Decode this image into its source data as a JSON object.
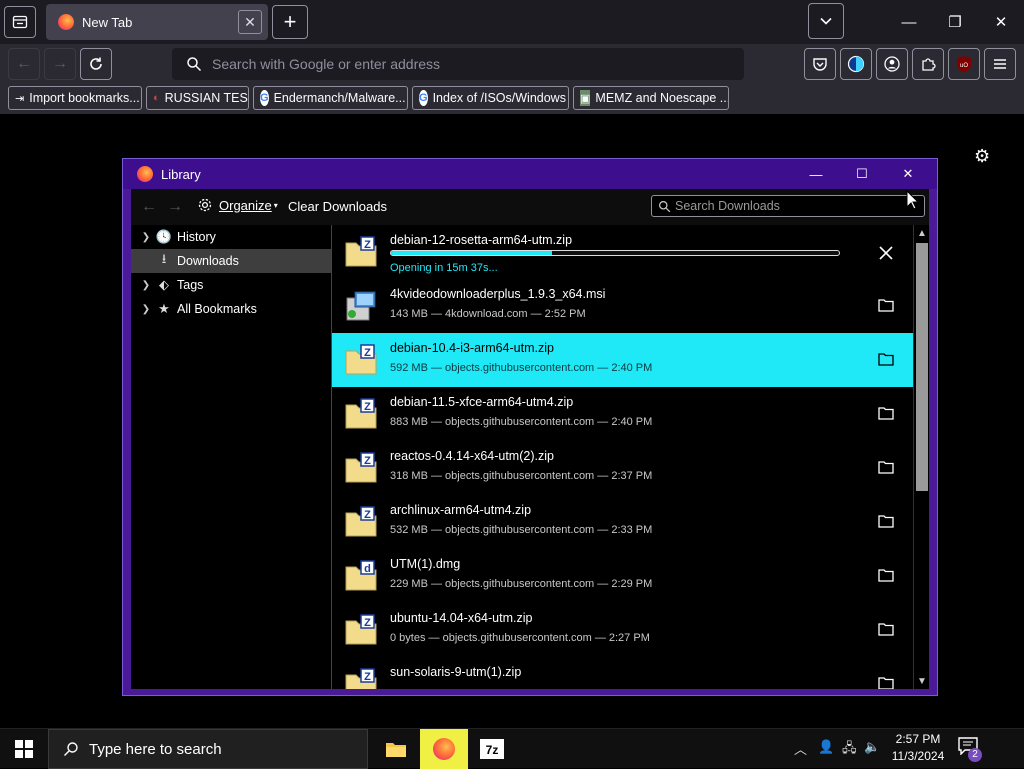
{
  "browser": {
    "active_tab": {
      "title": "New Tab",
      "close": "✕"
    },
    "new_tab": "+",
    "window": {
      "minimize": "—",
      "restore": "❐",
      "close": "✕"
    },
    "url_placeholder": "Search with Google or enter address",
    "bookmarks": [
      {
        "label": "Import bookmarks...",
        "icon": "import-icon"
      },
      {
        "label": "RUSSIAN TEST",
        "icon": "site-icon"
      },
      {
        "label": "Endermanch/Malware...",
        "icon": "google-icon"
      },
      {
        "label": "Index of /ISOs/Windows",
        "icon": "google-icon"
      },
      {
        "label": "MEMZ and Noescape ...",
        "icon": "video-icon"
      }
    ]
  },
  "library": {
    "title": "Library",
    "controls": {
      "minimize": "—",
      "maximize": "☐",
      "close": "✕"
    },
    "toolbar": {
      "organize": "Organize",
      "clear": "Clear Downloads",
      "search_placeholder": "Search Downloads"
    },
    "tree": [
      {
        "label": "History",
        "icon": "clock-icon",
        "twisty": "❯",
        "selected": false
      },
      {
        "label": "Downloads",
        "icon": "download-icon",
        "twisty": "",
        "selected": true
      },
      {
        "label": "Tags",
        "icon": "tag-icon",
        "twisty": "❯",
        "selected": false
      },
      {
        "label": "All Bookmarks",
        "icon": "star-icon",
        "twisty": "❯",
        "selected": false
      }
    ],
    "downloads": [
      {
        "name": "debian-12-rosetta-arm64-utm.zip",
        "status": "Opening in 15m 37s...",
        "progress": 0.36,
        "in_progress": true,
        "icon": "zip-icon"
      },
      {
        "name": "4kvideodownloaderplus_1.9.3_x64.msi",
        "status": "143 MB — 4kdownload.com — 2:52 PM",
        "icon": "msi-icon"
      },
      {
        "name": "debian-10.4-i3-arm64-utm.zip",
        "status": "592 MB — objects.githubusercontent.com — 2:40 PM",
        "icon": "zip-icon",
        "selected": true
      },
      {
        "name": "debian-11.5-xfce-arm64-utm4.zip",
        "status": "883 MB — objects.githubusercontent.com — 2:40 PM",
        "icon": "zip-icon"
      },
      {
        "name": "reactos-0.4.14-x64-utm(2).zip",
        "status": "318 MB — objects.githubusercontent.com — 2:37 PM",
        "icon": "zip-icon"
      },
      {
        "name": "archlinux-arm64-utm4.zip",
        "status": "532 MB — objects.githubusercontent.com — 2:33 PM",
        "icon": "zip-icon"
      },
      {
        "name": "UTM(1).dmg",
        "status": "229 MB — objects.githubusercontent.com — 2:29 PM",
        "icon": "dmg-icon"
      },
      {
        "name": "ubuntu-14.04-x64-utm.zip",
        "status": "0 bytes — objects.githubusercontent.com — 2:27 PM",
        "icon": "zip-icon"
      },
      {
        "name": "sun-solaris-9-utm(1).zip",
        "status": "",
        "icon": "zip-icon"
      }
    ]
  },
  "taskbar": {
    "search_placeholder": "Type here to search",
    "time": "2:57 PM",
    "date": "11/3/2024",
    "notifications": "2"
  }
}
